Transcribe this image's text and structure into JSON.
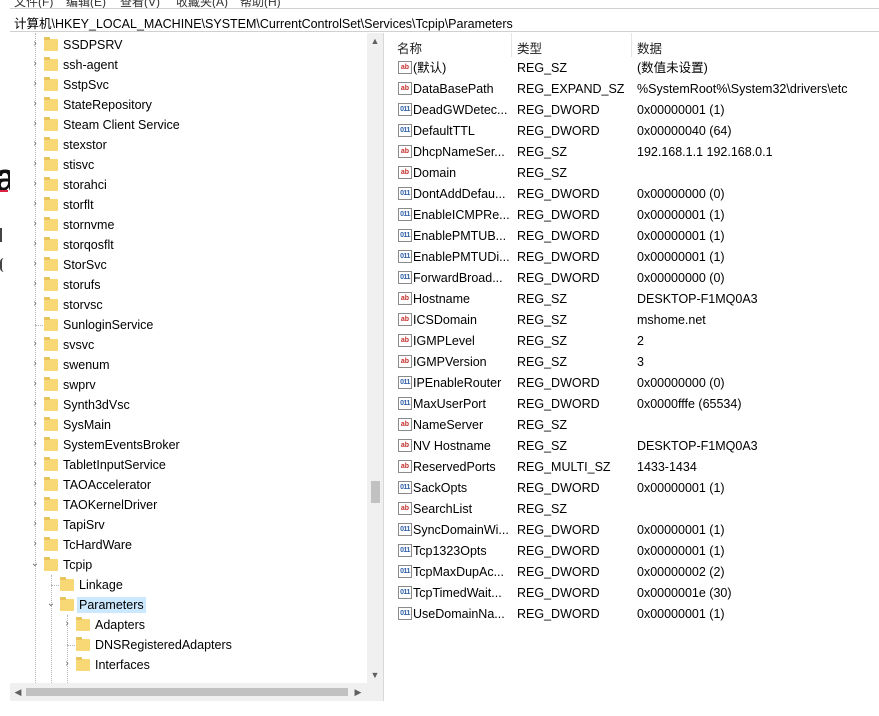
{
  "menu": [
    "文件(F)",
    "编辑(E)",
    "查看(V)",
    "收藏夹(A)",
    "帮助(H)"
  ],
  "address": "计算机\\HKEY_LOCAL_MACHINE\\SYSTEM\\CurrentControlSet\\Services\\Tcpip\\Parameters",
  "tree": [
    {
      "label": "SSDPSRV",
      "expander": "collapsed"
    },
    {
      "label": "ssh-agent",
      "expander": "collapsed"
    },
    {
      "label": "SstpSvc",
      "expander": "collapsed"
    },
    {
      "label": "StateRepository",
      "expander": "collapsed"
    },
    {
      "label": "Steam Client Service",
      "expander": "collapsed"
    },
    {
      "label": "stexstor",
      "expander": "collapsed"
    },
    {
      "label": "stisvc",
      "expander": "collapsed"
    },
    {
      "label": "storahci",
      "expander": "collapsed"
    },
    {
      "label": "storflt",
      "expander": "collapsed"
    },
    {
      "label": "stornvme",
      "expander": "collapsed"
    },
    {
      "label": "storqosflt",
      "expander": "collapsed"
    },
    {
      "label": "StorSvc",
      "expander": "collapsed"
    },
    {
      "label": "storufs",
      "expander": "collapsed"
    },
    {
      "label": "storvsc",
      "expander": "collapsed"
    },
    {
      "label": "SunloginService",
      "expander": "none"
    },
    {
      "label": "svsvc",
      "expander": "collapsed"
    },
    {
      "label": "swenum",
      "expander": "collapsed"
    },
    {
      "label": "swprv",
      "expander": "collapsed"
    },
    {
      "label": "Synth3dVsc",
      "expander": "collapsed"
    },
    {
      "label": "SysMain",
      "expander": "collapsed"
    },
    {
      "label": "SystemEventsBroker",
      "expander": "collapsed"
    },
    {
      "label": "TabletInputService",
      "expander": "collapsed"
    },
    {
      "label": "TAOAccelerator",
      "expander": "collapsed"
    },
    {
      "label": "TAOKernelDriver",
      "expander": "collapsed"
    },
    {
      "label": "TapiSrv",
      "expander": "collapsed"
    },
    {
      "label": "TcHardWare",
      "expander": "collapsed"
    },
    {
      "label": "Tcpip",
      "expander": "expanded"
    },
    {
      "label": "Linkage",
      "expander": "none",
      "depth": 1
    },
    {
      "label": "Parameters",
      "expander": "expanded",
      "depth": 1,
      "selected": true
    },
    {
      "label": "Adapters",
      "expander": "collapsed",
      "depth": 2
    },
    {
      "label": "DNSRegisteredAdapters",
      "expander": "none",
      "depth": 2
    },
    {
      "label": "Interfaces",
      "expander": "collapsed",
      "depth": 2
    }
  ],
  "columns": {
    "name": "名称",
    "type": "类型",
    "data": "数据"
  },
  "values": [
    {
      "icon": "sz",
      "name": "(默认)",
      "type": "REG_SZ",
      "data": "(数值未设置)"
    },
    {
      "icon": "sz",
      "name": "DataBasePath",
      "type": "REG_EXPAND_SZ",
      "data": "%SystemRoot%\\System32\\drivers\\etc"
    },
    {
      "icon": "bin",
      "name": "DeadGWDetec...",
      "type": "REG_DWORD",
      "data": "0x00000001 (1)"
    },
    {
      "icon": "bin",
      "name": "DefaultTTL",
      "type": "REG_DWORD",
      "data": "0x00000040 (64)"
    },
    {
      "icon": "sz",
      "name": "DhcpNameSer...",
      "type": "REG_SZ",
      "data": "192.168.1.1 192.168.0.1"
    },
    {
      "icon": "sz",
      "name": "Domain",
      "type": "REG_SZ",
      "data": ""
    },
    {
      "icon": "bin",
      "name": "DontAddDefau...",
      "type": "REG_DWORD",
      "data": "0x00000000 (0)"
    },
    {
      "icon": "bin",
      "name": "EnableICMPRe...",
      "type": "REG_DWORD",
      "data": "0x00000001 (1)"
    },
    {
      "icon": "bin",
      "name": "EnablePMTUB...",
      "type": "REG_DWORD",
      "data": "0x00000001 (1)"
    },
    {
      "icon": "bin",
      "name": "EnablePMTUDi...",
      "type": "REG_DWORD",
      "data": "0x00000001 (1)"
    },
    {
      "icon": "bin",
      "name": "ForwardBroad...",
      "type": "REG_DWORD",
      "data": "0x00000000 (0)"
    },
    {
      "icon": "sz",
      "name": "Hostname",
      "type": "REG_SZ",
      "data": "DESKTOP-F1MQ0A3"
    },
    {
      "icon": "sz",
      "name": "ICSDomain",
      "type": "REG_SZ",
      "data": "mshome.net"
    },
    {
      "icon": "sz",
      "name": "IGMPLevel",
      "type": "REG_SZ",
      "data": "2"
    },
    {
      "icon": "sz",
      "name": "IGMPVersion",
      "type": "REG_SZ",
      "data": "3"
    },
    {
      "icon": "bin",
      "name": "IPEnableRouter",
      "type": "REG_DWORD",
      "data": "0x00000000 (0)"
    },
    {
      "icon": "bin",
      "name": "MaxUserPort",
      "type": "REG_DWORD",
      "data": "0x0000fffe (65534)"
    },
    {
      "icon": "sz",
      "name": "NameServer",
      "type": "REG_SZ",
      "data": ""
    },
    {
      "icon": "sz",
      "name": "NV Hostname",
      "type": "REG_SZ",
      "data": "DESKTOP-F1MQ0A3"
    },
    {
      "icon": "sz",
      "name": "ReservedPorts",
      "type": "REG_MULTI_SZ",
      "data": "1433-1434"
    },
    {
      "icon": "bin",
      "name": "SackOpts",
      "type": "REG_DWORD",
      "data": "0x00000001 (1)"
    },
    {
      "icon": "sz",
      "name": "SearchList",
      "type": "REG_SZ",
      "data": ""
    },
    {
      "icon": "bin",
      "name": "SyncDomainWi...",
      "type": "REG_DWORD",
      "data": "0x00000001 (1)"
    },
    {
      "icon": "bin",
      "name": "Tcp1323Opts",
      "type": "REG_DWORD",
      "data": "0x00000001 (1)"
    },
    {
      "icon": "bin",
      "name": "TcpMaxDupAc...",
      "type": "REG_DWORD",
      "data": "0x00000002 (2)"
    },
    {
      "icon": "bin",
      "name": "TcpTimedWait...",
      "type": "REG_DWORD",
      "data": "0x0000001e (30)"
    },
    {
      "icon": "bin",
      "name": "UseDomainNa...",
      "type": "REG_DWORD",
      "data": "0x00000001 (1)"
    }
  ],
  "icons": {
    "sz": "ab",
    "bin": "011",
    "chevron_right": "›",
    "chevron_down": "⌄",
    "up": "▲",
    "down": "▼",
    "left": "◀",
    "right": "▶"
  },
  "colors": {
    "selection": "#cce8ff",
    "folder": "#f8d775",
    "string_icon": "#c4302b",
    "binary_icon": "#2d5fa8"
  }
}
